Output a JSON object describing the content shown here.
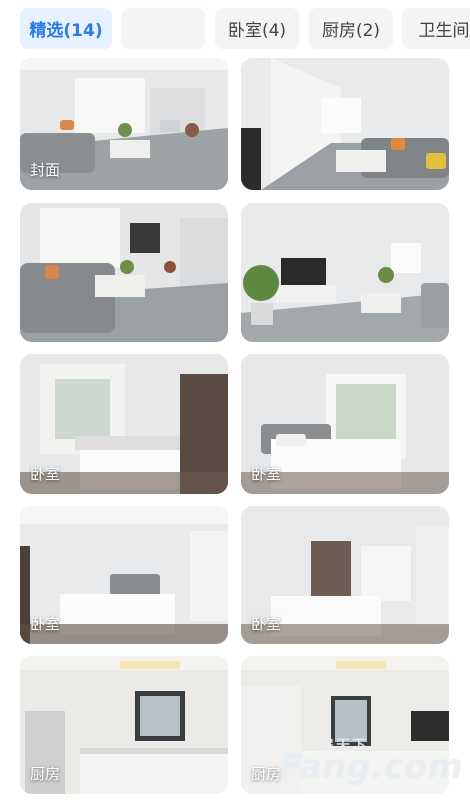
{
  "tabs": [
    {
      "label": "精选(14)",
      "active": true
    },
    {
      "label": "",
      "active": false
    },
    {
      "label": "卧室(4)",
      "active": false
    },
    {
      "label": "厨房(2)",
      "active": false
    },
    {
      "label": "卫生间",
      "active": false
    }
  ],
  "photos": [
    {
      "caption": "封面"
    },
    {
      "caption": ""
    },
    {
      "caption": ""
    },
    {
      "caption": ""
    },
    {
      "caption": "卧室"
    },
    {
      "caption": "卧室"
    },
    {
      "caption": "卧室"
    },
    {
      "caption": "卧室"
    },
    {
      "caption": "厨房"
    },
    {
      "caption": "厨房"
    }
  ],
  "watermark": {
    "top": "房天下",
    "brand": "Fang.com"
  }
}
